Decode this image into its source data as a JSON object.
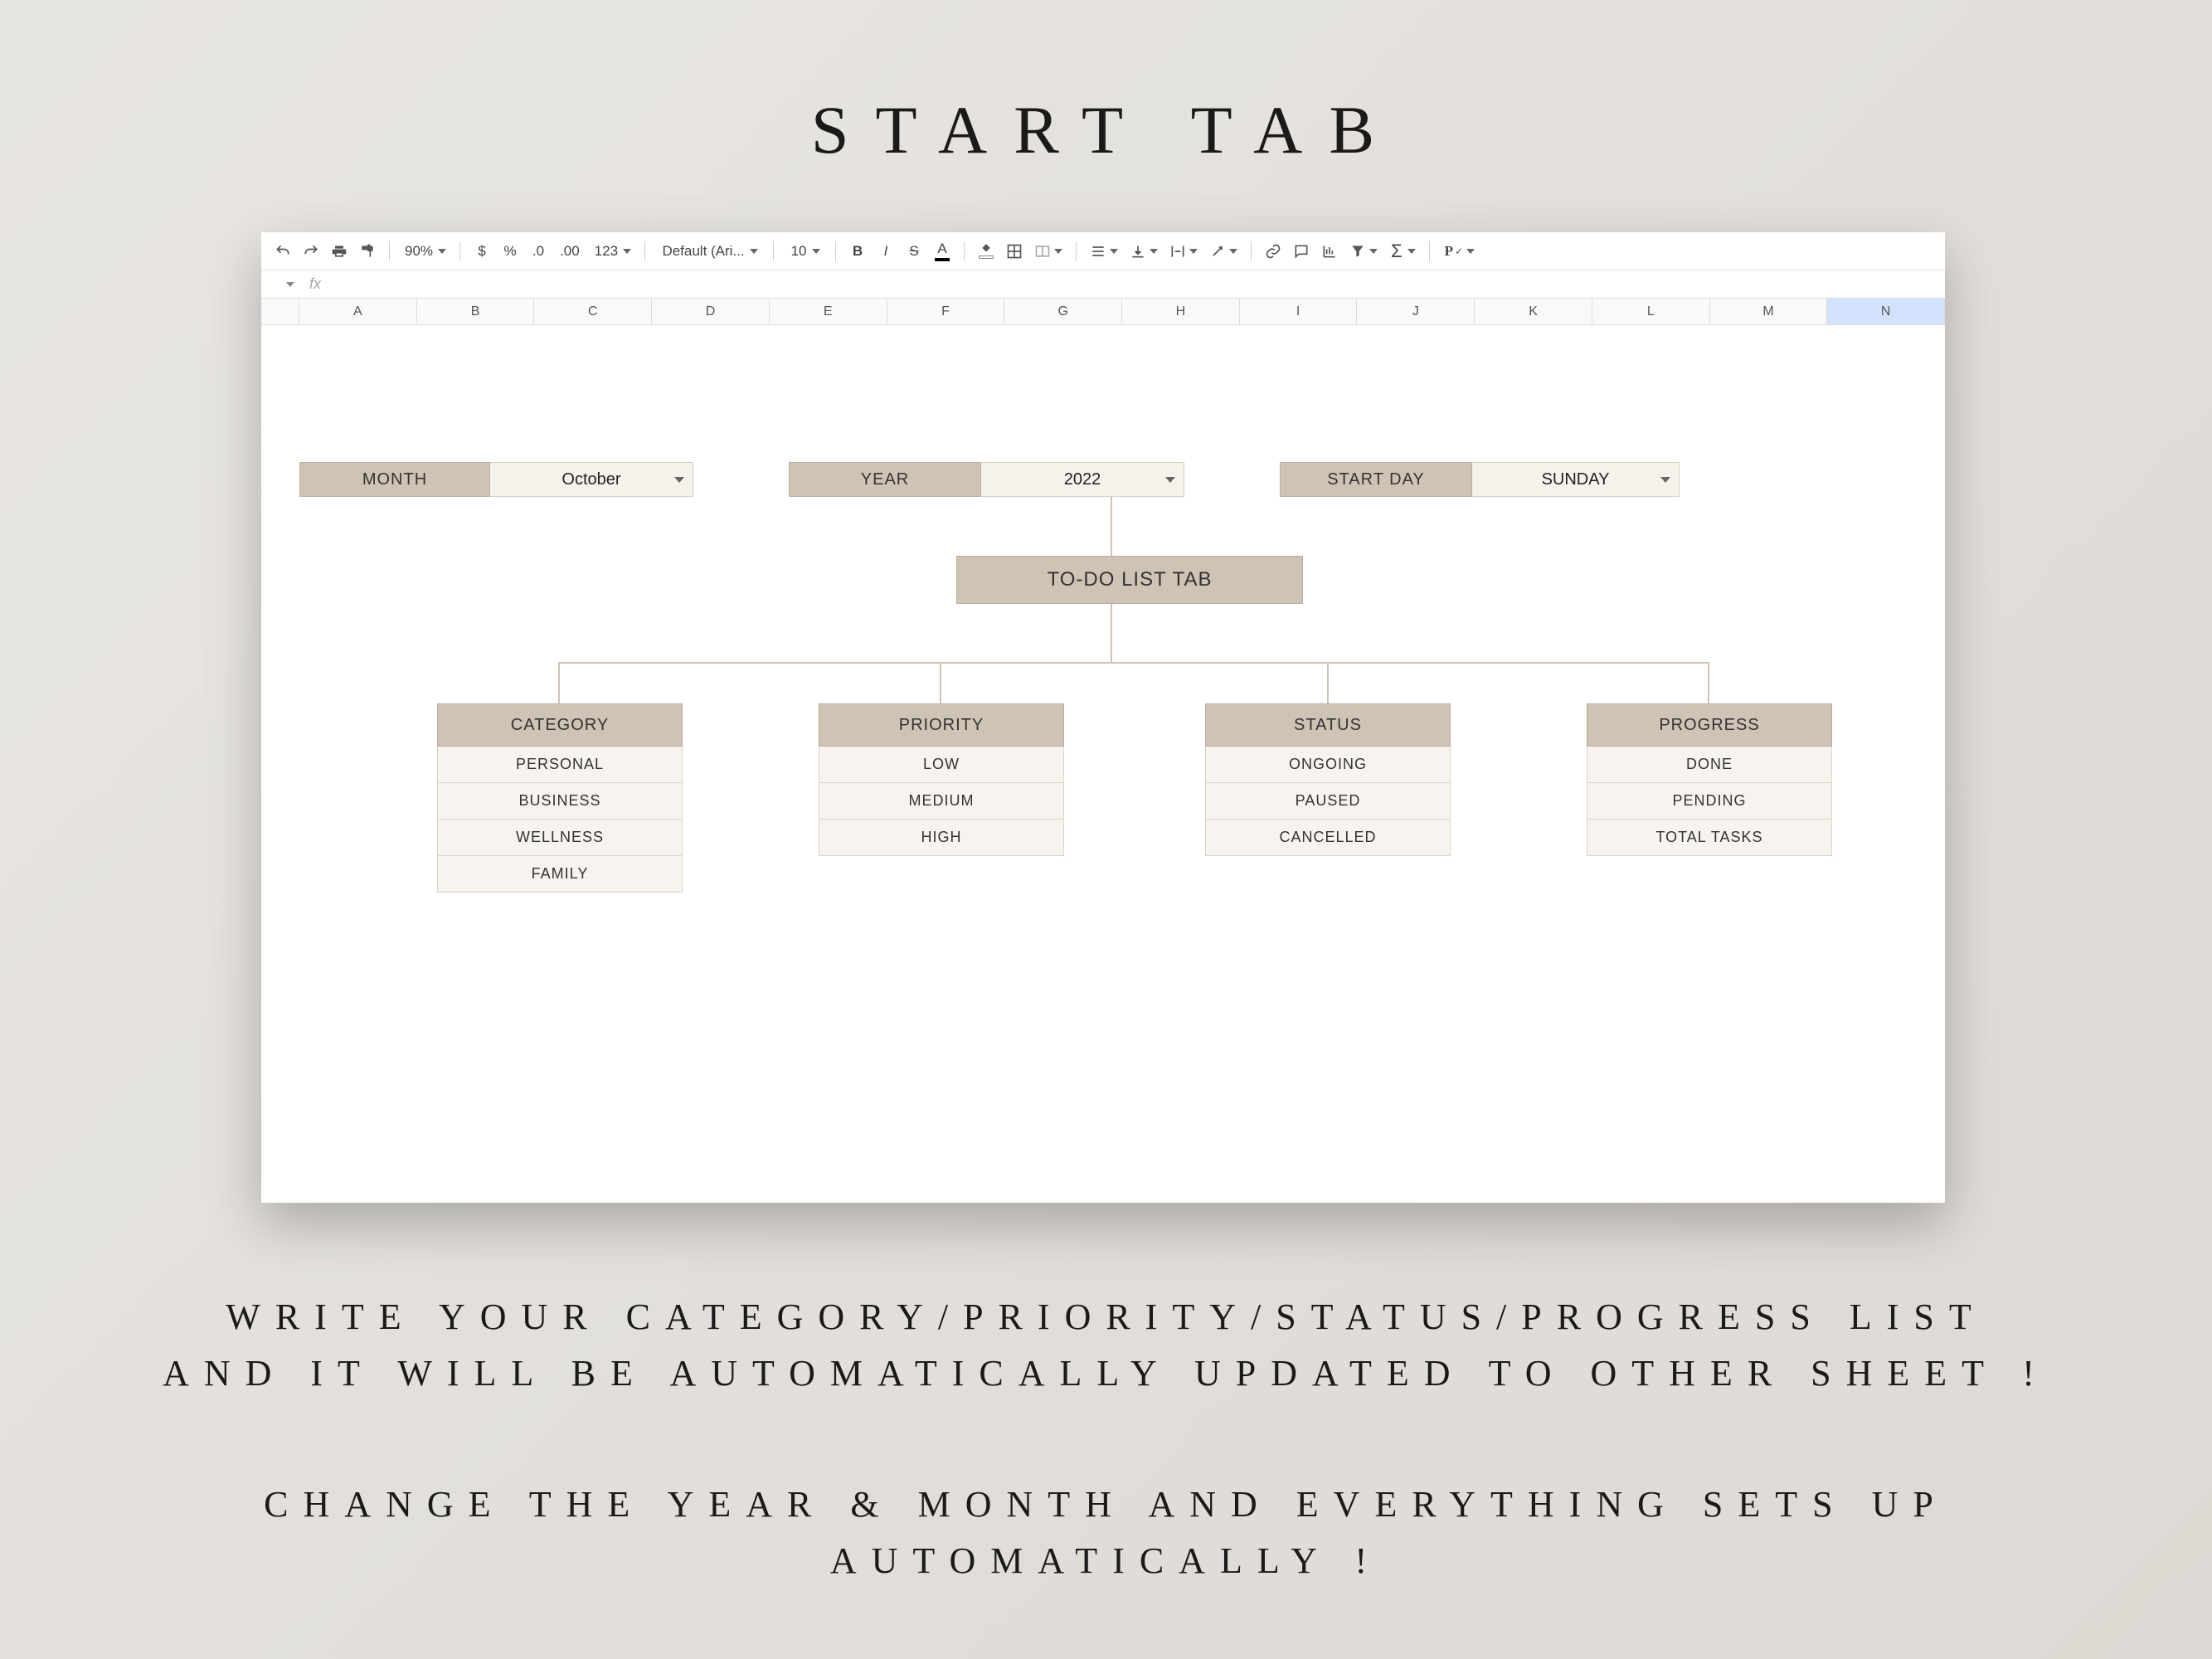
{
  "title": "START TAB",
  "toolbar": {
    "zoom": "90%",
    "currency": "$",
    "percent": "%",
    "dec_dec": ".0",
    "inc_dec": ".00",
    "num_fmt": "123",
    "font": "Default (Ari...",
    "font_size": "10",
    "bold": "B",
    "italic": "I",
    "strike": "S",
    "text_color": "A",
    "fn_P": "P"
  },
  "fx_label": "fx",
  "columns": [
    "A",
    "B",
    "C",
    "D",
    "E",
    "F",
    "G",
    "H",
    "I",
    "J",
    "K",
    "L",
    "M",
    "N"
  ],
  "selectors": {
    "month_label": "MONTH",
    "month_value": "October",
    "year_label": "YEAR",
    "year_value": "2022",
    "startday_label": "START DAY",
    "startday_value": "SUNDAY"
  },
  "section_title": "TO-DO LIST TAB",
  "blocks": {
    "category": {
      "head": "CATEGORY",
      "items": [
        "PERSONAL",
        "BUSINESS",
        "WELLNESS",
        "FAMILY"
      ]
    },
    "priority": {
      "head": "PRIORITY",
      "items": [
        "LOW",
        "MEDIUM",
        "HIGH"
      ]
    },
    "status": {
      "head": "STATUS",
      "items": [
        "ONGOING",
        "PAUSED",
        "CANCELLED"
      ]
    },
    "progress": {
      "head": "PROGRESS",
      "items": [
        "DONE",
        "PENDING",
        "TOTAL TASKS"
      ]
    }
  },
  "caption1_l1": "WRITE YOUR CATEGORY/PRIORITY/STATUS/PROGRESS LIST",
  "caption1_l2": "AND IT WILL BE AUTOMATICALLY UPDATED TO OTHER SHEET !",
  "caption2_l1": "CHANGE THE YEAR & MONTH AND EVERYTHING SETS UP",
  "caption2_l2": "AUTOMATICALLY !"
}
